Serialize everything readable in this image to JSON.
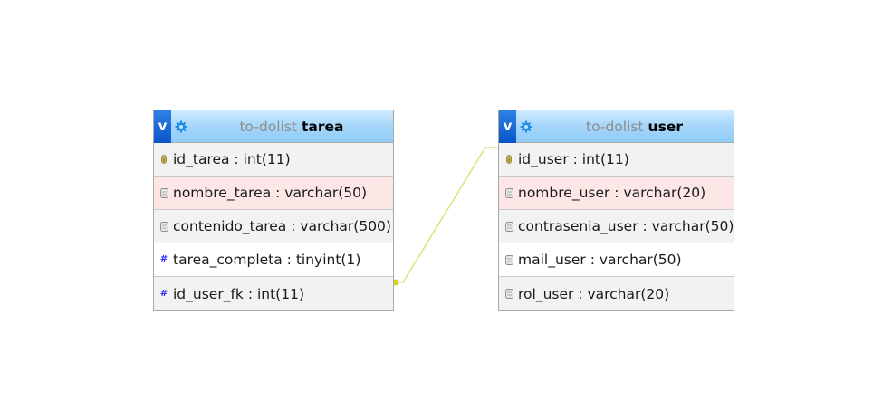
{
  "tables": [
    {
      "id": "tarea",
      "database": "to-dolist",
      "name": "tarea",
      "fields": [
        {
          "label": "id_tarea : int(11)",
          "icon": "key-icon",
          "style": "gray"
        },
        {
          "label": "nombre_tarea : varchar(50)",
          "icon": "field-icon",
          "style": "pink"
        },
        {
          "label": "contenido_tarea : varchar(500)",
          "icon": "field-icon",
          "style": "gray"
        },
        {
          "label": "tarea_completa : tinyint(1)",
          "icon": "numeric-icon",
          "style": "white"
        },
        {
          "label": "id_user_fk : int(11)",
          "icon": "numeric-icon",
          "style": "gray"
        }
      ]
    },
    {
      "id": "user",
      "database": "to-dolist",
      "name": "user",
      "fields": [
        {
          "label": "id_user : int(11)",
          "icon": "key-icon",
          "style": "gray"
        },
        {
          "label": "nombre_user : varchar(20)",
          "icon": "field-icon",
          "style": "pink"
        },
        {
          "label": "contrasenia_user : varchar(50)",
          "icon": "field-icon",
          "style": "gray"
        },
        {
          "label": "mail_user : varchar(50)",
          "icon": "field-icon",
          "style": "white"
        },
        {
          "label": "rol_user : varchar(20)",
          "icon": "field-icon",
          "style": "gray"
        }
      ]
    }
  ],
  "header_badge": "v",
  "relation": {
    "from": "tarea.id_user_fk",
    "to": "user.id_user",
    "color": "#e4e07f"
  },
  "colors": {
    "header_top": "#cfeaff",
    "header_bottom": "#8ecbf7",
    "badge": "#0a56c9",
    "pink_row": "#fde6e6",
    "gray_row": "#f2f2f2",
    "numeric_icon": "#2a2aff"
  }
}
